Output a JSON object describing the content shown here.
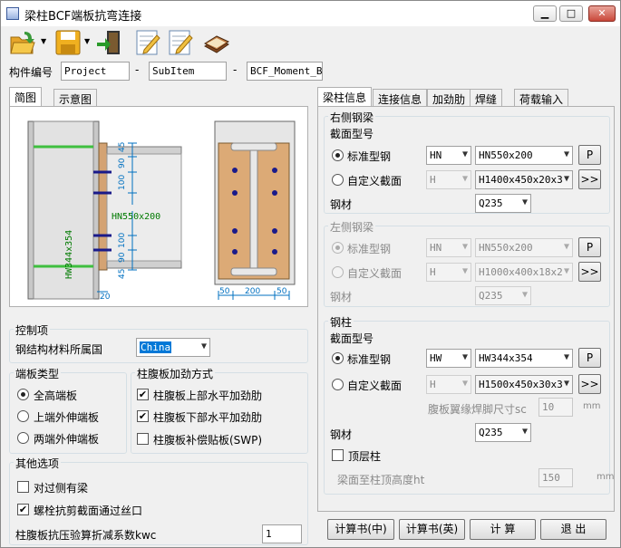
{
  "window": {
    "title": "梁柱BCF端板抗弯连接",
    "minimize": "▁",
    "maximize": "□",
    "close": "✕"
  },
  "toolbar": {
    "icons": [
      "open-folder-icon",
      "save-disk-icon",
      "exit-door-icon",
      "edit-pencil-icon",
      "edit-pencil-icon",
      "book-icon"
    ]
  },
  "component": {
    "label": "构件编号",
    "project": "Project",
    "sep1": "-",
    "subitem": "SubItem",
    "sep2": "-",
    "name": "BCF_Moment_BoltEndPlate"
  },
  "left_tabs": [
    "简图",
    "示意图"
  ],
  "diagram": {
    "beam_label": "HN550x200",
    "column_label": "HW344x354",
    "dims_top": [
      "45",
      "90",
      "100"
    ],
    "dims_bottom": [
      "100",
      "90",
      "45"
    ],
    "dim_20": "20",
    "dims_plan": [
      "50",
      "200",
      "50"
    ]
  },
  "control": {
    "title": "控制项",
    "country_label": "钢结构材料所属国",
    "country_value": "China"
  },
  "endplate": {
    "title": "端板类型",
    "options": [
      "全高端板",
      "上端外伸端板",
      "两端外伸端板"
    ],
    "selected": 0
  },
  "stiffen": {
    "title": "柱腹板加劲方式",
    "options": [
      "柱腹板上部水平加劲肋",
      "柱腹板下部水平加劲肋",
      "柱腹板补偿贴板(SWP)"
    ],
    "checked": [
      true,
      true,
      false
    ]
  },
  "other": {
    "title": "其他选项",
    "opt1": "对过侧有梁",
    "opt2": "螺栓抗剪截面通过丝口",
    "kwc_label": "柱腹板抗压验算折减系数kwc",
    "kwc_value": "1"
  },
  "right_tabs": [
    "梁柱信息",
    "连接信息",
    "加劲肋",
    "焊缝",
    "荷载输入"
  ],
  "right_beam": {
    "title": "右侧钢梁",
    "section_label": "截面型号",
    "std_label": "标准型钢",
    "custom_label": "自定义截面",
    "type": "HN",
    "std_value": "HN550x200",
    "custom_type": "H",
    "custom_value": "H1400x450x20x3",
    "p": "P",
    "more": ">>",
    "mat_label": "钢材",
    "mat": "Q235"
  },
  "left_beam": {
    "title": "左侧钢梁",
    "section_label": "截面型号",
    "std_label": "标准型钢",
    "custom_label": "自定义截面",
    "type": "HN",
    "std_value": "HN550x200",
    "custom_type": "H",
    "custom_value": "H1000x400x18x2",
    "p": "P",
    "more": ">>",
    "mat_label": "钢材",
    "mat": "Q235"
  },
  "column": {
    "title": "钢柱",
    "section_label": "截面型号",
    "std_label": "标准型钢",
    "custom_label": "自定义截面",
    "type": "HW",
    "std_value": "HW344x354",
    "custom_type": "H",
    "custom_value": "H1500x450x30x3",
    "p": "P",
    "more": ">>",
    "weld_label": "腹板翼缘焊脚尺寸sc",
    "weld_value": "10",
    "weld_unit": "mm",
    "mat_label": "钢材",
    "mat": "Q235",
    "top_label": "顶层柱",
    "height_label": "梁面至柱顶高度ht",
    "height_value": "150",
    "height_unit": "mm"
  },
  "bottom": {
    "calc_cn": "计算书(中)",
    "calc_en": "计算书(英)",
    "calc": "计  算",
    "exit": "退  出"
  }
}
